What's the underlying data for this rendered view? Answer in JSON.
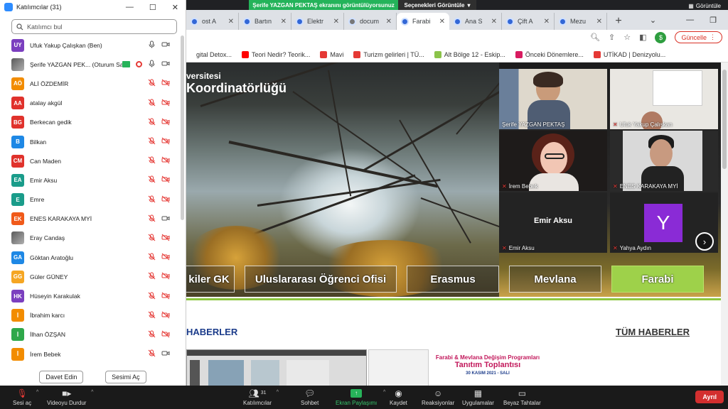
{
  "share_banner": {
    "status": "Şerife YAZGAN PEKTAŞ ekranını görüntülüyorsunuz",
    "options": "Seçenekleri Görüntüle"
  },
  "top_right_label": "Görüntüle",
  "browser": {
    "tabs": [
      {
        "label": "ost A",
        "active": false
      },
      {
        "label": "Bartın",
        "active": false
      },
      {
        "label": "Elektr",
        "active": false
      },
      {
        "label": "docum",
        "active": false,
        "gray": true
      },
      {
        "label": "Farabi",
        "active": true
      },
      {
        "label": "Ana S",
        "active": false
      },
      {
        "label": "Çift A",
        "active": false
      },
      {
        "label": "Mezu",
        "active": false
      }
    ],
    "update_label": "Güncelle",
    "profile_letter": "$",
    "bookmarks": [
      {
        "label": "gital Detox...",
        "color": "#ffffff"
      },
      {
        "label": "Teori Nedir? Teorik...",
        "color": "#ff0000"
      },
      {
        "label": "Mavi",
        "color": "#e53935"
      },
      {
        "label": "Turizm gelirleri | TÜ...",
        "color": "#e53935"
      },
      {
        "label": "Alt Bölge 12 - Eskip...",
        "color": "#8bc34a"
      },
      {
        "label": "Önceki Dönemlere...",
        "color": "#d81b60"
      },
      {
        "label": "UTİKAD | Denizyolu...",
        "color": "#e53935"
      }
    ]
  },
  "website": {
    "hero_line1": "versitesi",
    "hero_line2": "Koordinatörlüğü",
    "nav_buttons": [
      "kiler GK",
      "Uluslararası Öğrenci Ofisi",
      "Erasmus",
      "Mevlana",
      "Farabi"
    ],
    "news_left": "HABERLER",
    "news_all": "TÜM HABERLER",
    "news_card": {
      "line1": "Farabi & Mevlana Değişim Programları",
      "line2": "Tanıtım Toplantısı",
      "line3": "30 KASIM 2021 - SALI"
    }
  },
  "gallery": {
    "tiles": [
      {
        "name": "Şerife YAZGAN PEKTAŞ",
        "muted": false,
        "active": true
      },
      {
        "name": "Ufuk Yakup Çalışkan",
        "muted": true
      },
      {
        "name": "İrem Bebek",
        "muted": true
      },
      {
        "name": "ENES KARAKAYA MYİ",
        "muted": true
      },
      {
        "name": "Emir Aksu",
        "center_name": "Emir Aksu",
        "muted": true
      },
      {
        "name": "Yahya Aydın",
        "avatar_letter": "Y",
        "muted": true
      }
    ]
  },
  "participants_panel": {
    "title": "Katılımcılar (31)",
    "search_placeholder": "Katılımcı bul",
    "participants": [
      {
        "initials": "UY",
        "name": "Ufuk Yakup Çalışkan (Ben)",
        "color": "#7b3fbf",
        "mic": "on",
        "cam": "on"
      },
      {
        "initials": "",
        "name": "Şerife YAZGAN PEK... (Oturum Sahibi)",
        "color": "photo",
        "mic": "on",
        "cam": "on",
        "host": true
      },
      {
        "initials": "AÖ",
        "name": "ALİ ÖZDEMİR",
        "color": "#f28c00",
        "mic": "off",
        "cam": "off"
      },
      {
        "initials": "AA",
        "name": "atalay akgül",
        "color": "#e0322c",
        "mic": "off",
        "cam": "off"
      },
      {
        "initials": "BG",
        "name": "Berkecan gedik",
        "color": "#e0322c",
        "mic": "off",
        "cam": "off"
      },
      {
        "initials": "B",
        "name": "Bilkan",
        "color": "#1e88e5",
        "mic": "off",
        "cam": "off"
      },
      {
        "initials": "CM",
        "name": "Can Maden",
        "color": "#e0322c",
        "mic": "off",
        "cam": "off"
      },
      {
        "initials": "EA",
        "name": "Emir Aksu",
        "color": "#1a9c8a",
        "mic": "off",
        "cam": "off"
      },
      {
        "initials": "E",
        "name": "Emre",
        "color": "#1a9c8a",
        "mic": "off",
        "cam": "off"
      },
      {
        "initials": "EK",
        "name": "ENES KARAKAYA MYİ",
        "color": "#f05a1a",
        "mic": "off",
        "cam": "on"
      },
      {
        "initials": "",
        "name": "Eray Candaş",
        "color": "photo",
        "mic": "off",
        "cam": "off"
      },
      {
        "initials": "GA",
        "name": "Göktan Aratoğlu",
        "color": "#1e88e5",
        "mic": "off",
        "cam": "off"
      },
      {
        "initials": "GG",
        "name": "Güler GÜNEY",
        "color": "#f5a623",
        "mic": "off",
        "cam": "off"
      },
      {
        "initials": "HK",
        "name": "Hüseyin Karakulak",
        "color": "#7b3fbf",
        "mic": "off",
        "cam": "off"
      },
      {
        "initials": "İ",
        "name": "İbrahim karcı",
        "color": "#f28c00",
        "mic": "off",
        "cam": "off"
      },
      {
        "initials": "İ",
        "name": "İlhan ÖZŞAN",
        "color": "#2ea84a",
        "mic": "off",
        "cam": "off"
      },
      {
        "initials": "İ",
        "name": "İrem Bebek",
        "color": "#f28c00",
        "mic": "off",
        "cam": "on"
      }
    ],
    "invite_label": "Davet Edin",
    "unmute_label": "Sesimi Aç"
  },
  "toolbar": {
    "unmute": "Sesi aç",
    "video": "Videoyu Durdur",
    "participants": "Katılımcılar",
    "participant_count": "31",
    "chat": "Sohbet",
    "share": "Ekran Paylaşımı",
    "record": "Kaydet",
    "reactions": "Reaksiyonlar",
    "apps": "Uygulamalar",
    "whiteboard": "Beyaz Tahtalar",
    "leave": "Ayrıl"
  }
}
